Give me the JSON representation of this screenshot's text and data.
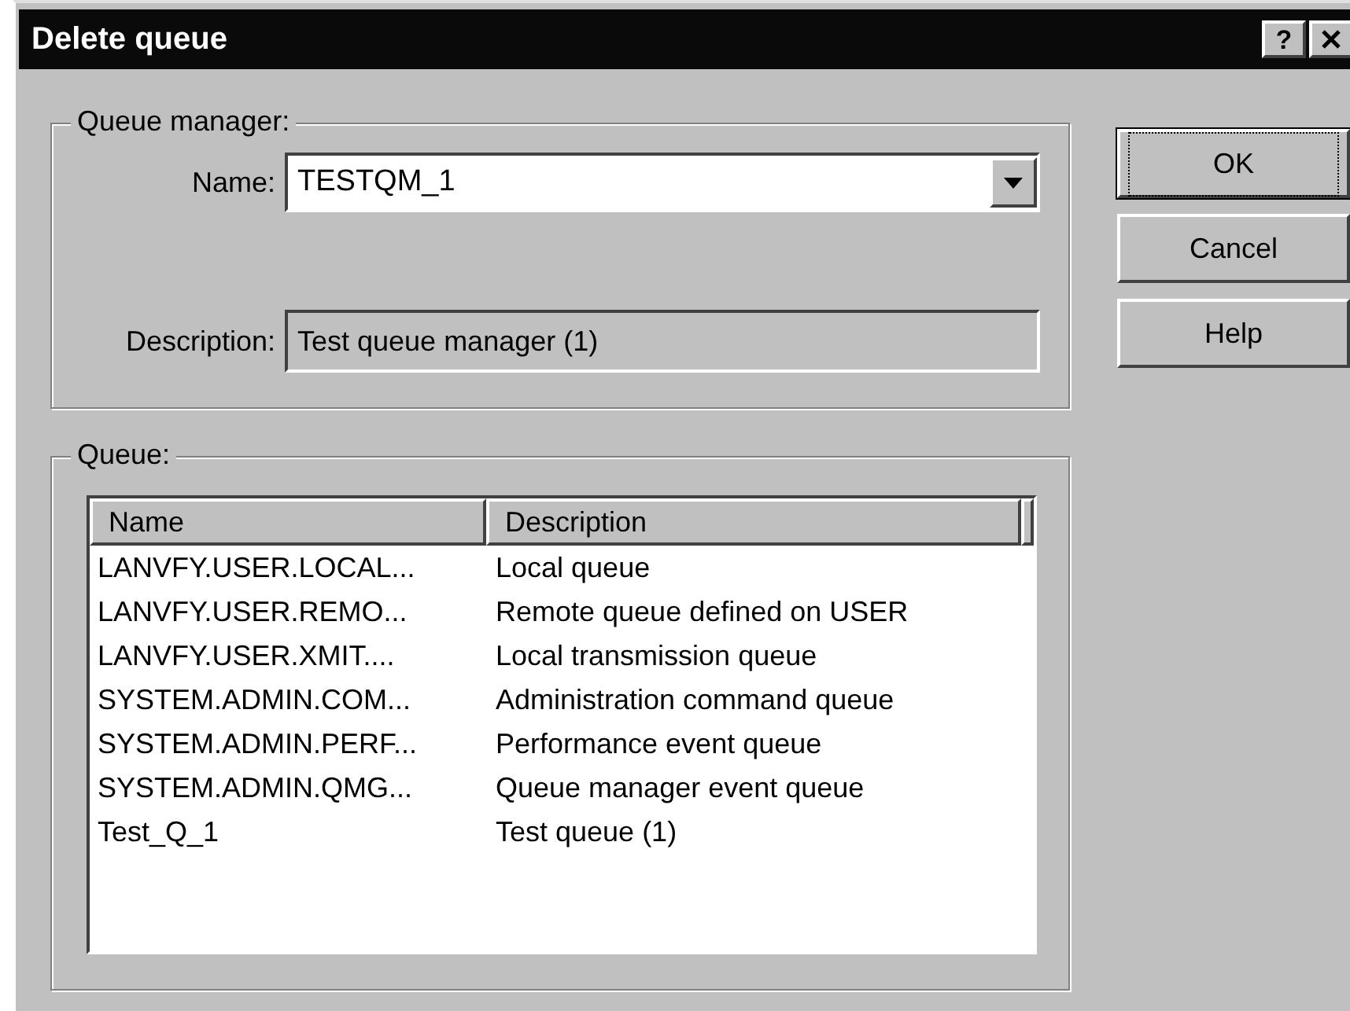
{
  "window": {
    "title": "Delete queue",
    "help_button": "?"
  },
  "queue_manager": {
    "legend": "Queue manager:",
    "name_label": "Name:",
    "name_value": "TESTQM_1",
    "description_label": "Description:",
    "description_value": "Test queue manager (1)"
  },
  "queue": {
    "legend": "Queue:",
    "columns": [
      "Name",
      "Description"
    ],
    "rows": [
      [
        "LANVFY.USER.LOCAL...",
        "Local queue"
      ],
      [
        "LANVFY.USER.REMO...",
        "Remote queue defined on USER"
      ],
      [
        "LANVFY.USER.XMIT....",
        "Local transmission queue"
      ],
      [
        "SYSTEM.ADMIN.COM...",
        "Administration command queue"
      ],
      [
        "SYSTEM.ADMIN.PERF...",
        "Performance event queue"
      ],
      [
        "SYSTEM.ADMIN.QMG...",
        "Queue manager event queue"
      ],
      [
        "Test_Q_1",
        "Test queue (1)"
      ]
    ]
  },
  "buttons": [
    {
      "label": "OK",
      "default": true
    },
    {
      "label": "Cancel",
      "default": false
    },
    {
      "label": "Help",
      "default": false
    }
  ]
}
